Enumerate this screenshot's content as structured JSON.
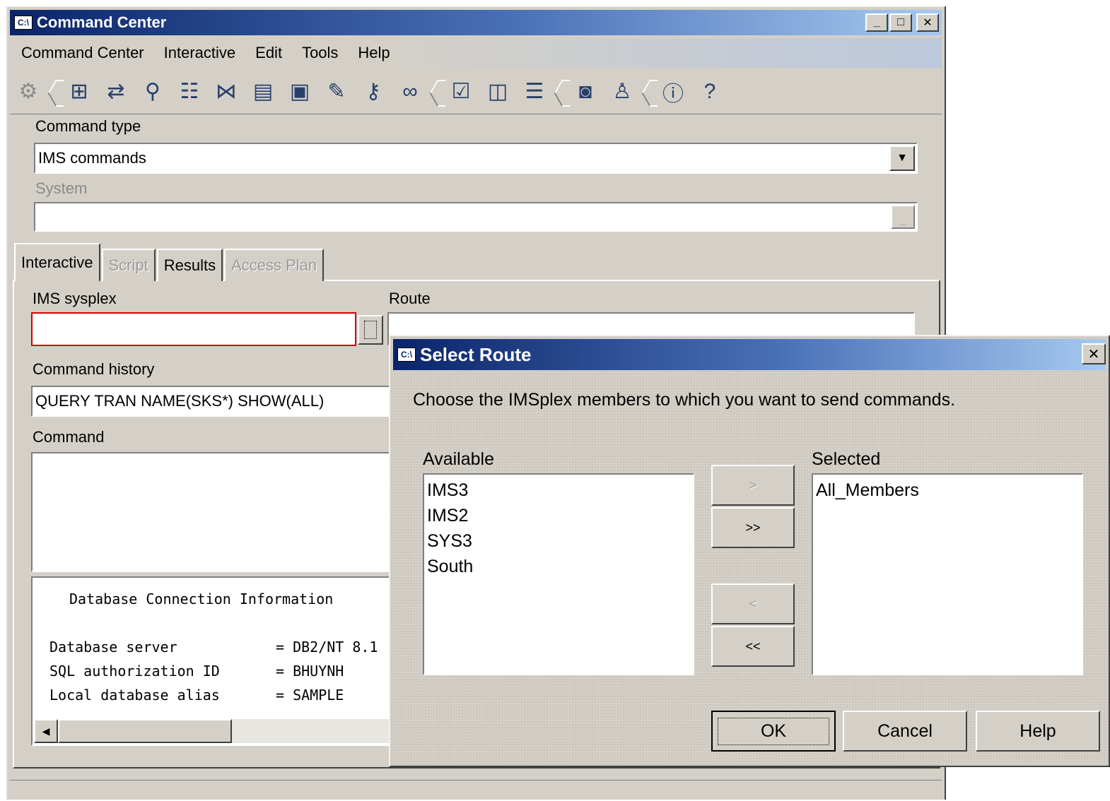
{
  "window": {
    "title": "Command Center",
    "app_icon": "C:\\",
    "minimize": "_",
    "maximize": "□",
    "close": "✕"
  },
  "menu": [
    "Command Center",
    "Interactive",
    "Edit",
    "Tools",
    "Help"
  ],
  "toolbar": {
    "icons": [
      {
        "name": "gears-icon",
        "glyph": "⚙"
      },
      {
        "name": "tree-icon",
        "glyph": "⊞"
      },
      {
        "name": "replication-icon",
        "glyph": "⇄"
      },
      {
        "name": "search-icon",
        "glyph": "⚲"
      },
      {
        "name": "database-icon",
        "glyph": "☷"
      },
      {
        "name": "network-icon",
        "glyph": "⋈"
      },
      {
        "name": "journal-icon",
        "glyph": "▤"
      },
      {
        "name": "monitor-icon",
        "glyph": "▣"
      },
      {
        "name": "notes-icon",
        "glyph": "✎"
      },
      {
        "name": "key-user-icon",
        "glyph": "⚷"
      },
      {
        "name": "link-icon",
        "glyph": "∞"
      },
      {
        "name": "task-icon",
        "glyph": "☑"
      },
      {
        "name": "window-icon",
        "glyph": "◫"
      },
      {
        "name": "list-icon",
        "glyph": "☰"
      },
      {
        "name": "book-icon",
        "glyph": "◙"
      },
      {
        "name": "users-icon",
        "glyph": "♙"
      },
      {
        "name": "info-icon",
        "glyph": "ⓘ"
      },
      {
        "name": "help-icon",
        "glyph": "?"
      }
    ]
  },
  "form": {
    "command_type_label": "Command type",
    "command_type_value": "IMS commands",
    "system_label": "System",
    "system_value": "",
    "dots": "...",
    "tabs": [
      {
        "label": "Interactive",
        "state": "active"
      },
      {
        "label": "Script",
        "state": "disabled"
      },
      {
        "label": "Results",
        "state": "normal"
      },
      {
        "label": "Access Plan",
        "state": "disabled"
      }
    ],
    "ims_sysplex_label": "IMS sysplex",
    "ims_sysplex_value": "",
    "route_label": "Route",
    "route_value": "",
    "command_history_label": "Command history",
    "command_history_value": "QUERY TRAN NAME(SKS*) SHOW(ALL)",
    "command_label": "Command",
    "command_value": ""
  },
  "output": {
    "heading": "Database Connection Information",
    "rows": [
      {
        "key": "Database server",
        "value": "= DB2/NT 8.1"
      },
      {
        "key": "SQL authorization ID",
        "value": "= BHUYNH"
      },
      {
        "key": "Local database alias",
        "value": "= SAMPLE"
      }
    ],
    "scroll_left": "◀"
  },
  "dialog": {
    "title": "Select Route",
    "close": "✕",
    "instruction": "Choose the IMSplex members to which you want to send commands.",
    "available_label": "Available",
    "available_items": [
      "IMS3",
      "IMS2",
      "SYS3",
      "South"
    ],
    "selected_label": "Selected",
    "selected_items": [
      "All_Members"
    ],
    "btn_add": ">",
    "btn_add_all": ">>",
    "btn_remove": "<",
    "btn_remove_all": "<<",
    "ok": "OK",
    "cancel": "Cancel",
    "help": "Help"
  }
}
